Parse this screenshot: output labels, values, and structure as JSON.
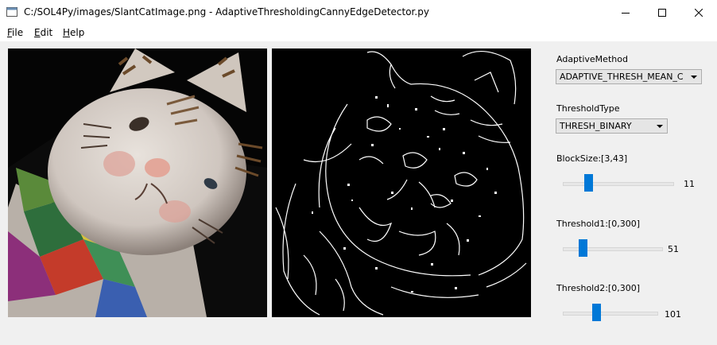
{
  "window": {
    "title": "C:/SOL4Py/images/SlantCatImage.png - AdaptiveThresholdingCannyEdgeDetector.py",
    "icon": "window-app-icon",
    "controls": [
      "minimize-icon",
      "maximize-icon",
      "close-icon"
    ]
  },
  "menu": {
    "file": {
      "mnemonic": "F",
      "rest": "ile"
    },
    "edit": {
      "mnemonic": "E",
      "rest": "dit"
    },
    "help": {
      "mnemonic": "H",
      "rest": "elp"
    }
  },
  "images": {
    "original": {
      "content": "photo of a ceramic cat figurine, slanted, on black background"
    },
    "edges": {
      "content": "white canny edge contours of the cat figurine on black background"
    }
  },
  "controls": {
    "adaptive_method": {
      "label": "AdaptiveMethod",
      "value": "ADAPTIVE_THRESH_MEAN_C"
    },
    "threshold_type": {
      "label": "ThresholdType",
      "value": "THRESH_BINARY"
    },
    "block_size": {
      "label": "BlockSize:[3,43]",
      "value": "11",
      "min": 3,
      "max": 43,
      "current": 11
    },
    "threshold1": {
      "label": "Threshold1:[0,300]",
      "value": "51",
      "min": 0,
      "max": 300,
      "current": 51
    },
    "threshold2": {
      "label": "Threshold2:[0,300]",
      "value": "101",
      "min": 0,
      "max": 300,
      "current": 101
    }
  },
  "colors": {
    "accent": "#0078d7",
    "background": "#f0f0f0"
  }
}
